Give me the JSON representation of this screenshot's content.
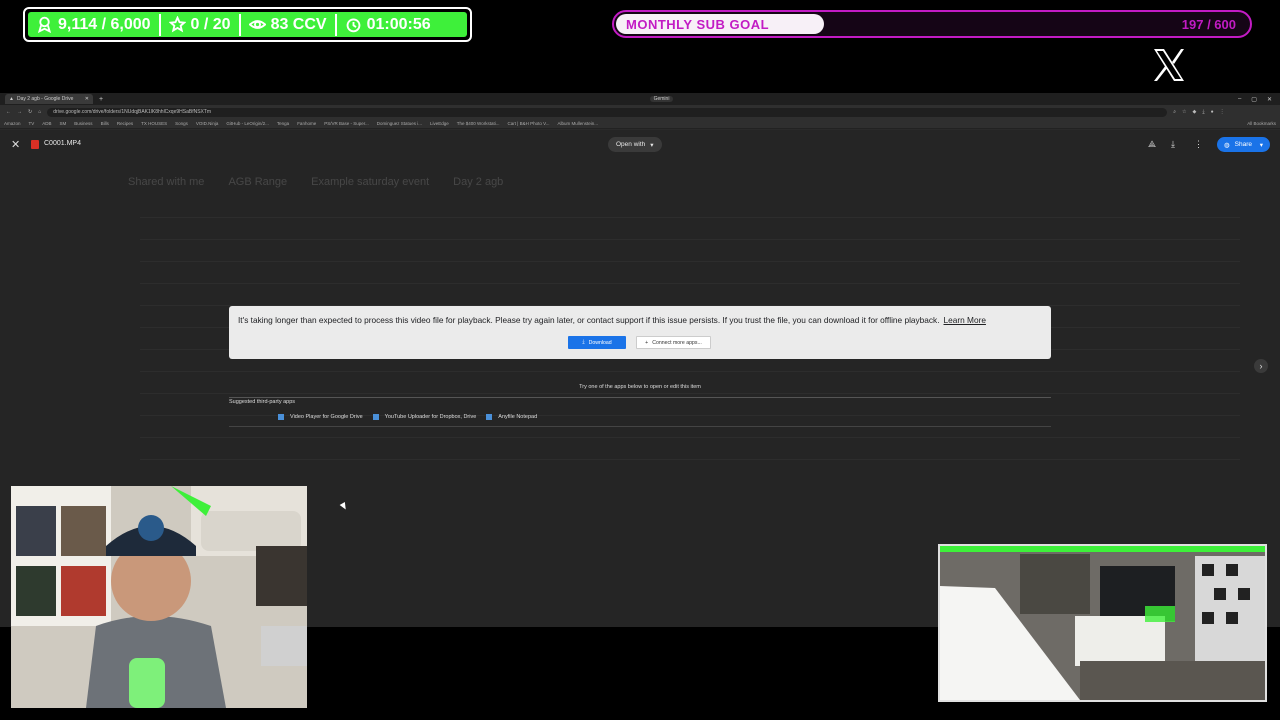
{
  "overlay": {
    "stats": [
      {
        "icon": "award-icon",
        "value": "9,114 / 6,000"
      },
      {
        "icon": "star-icon",
        "value": "0 / 20"
      },
      {
        "icon": "eye-icon",
        "value": "83 CCV"
      },
      {
        "icon": "timer-icon",
        "value": "01:00:56"
      }
    ],
    "goal": {
      "label": "MONTHLY SUB GOAL",
      "count": "197 / 600",
      "progress": 0.33
    },
    "social_icon": "x-logo-icon"
  },
  "browser": {
    "tab_title": "Day 2 agb - Google Drive",
    "tab_right_chip": "Gemini",
    "url": "drive.google.com/drive/folders/1NUdqjBAK1lK8hhlCxqe9HSaBfNSXTm",
    "bookmarks": [
      "Amazon",
      "TV",
      "ADB",
      "SM",
      "Business",
      "Bills",
      "Recipes",
      "TX HOUSES",
      "Songs",
      "VOID.Ninja",
      "GitHub - LeOrigin/2...",
      "Tenga",
      "Fanhome",
      "PS/VR Base - Super...",
      "Dominguez Statues i...",
      "LiveEdge",
      "The $400 Workstati...",
      "Cart | B&H Photo V...",
      "Album Mullenstein..."
    ],
    "bookmarks_all": "All Bookmarks"
  },
  "viewer": {
    "file_name": "C0001.MP4",
    "open_with": "Open with",
    "share": "Share",
    "message": "It's taking longer than expected to process this video file for playback. Please try again later, or contact support if this issue persists. If you trust the file, you can download it for offline playback.",
    "learn_more": "Learn More",
    "download_label": "Download",
    "connect_label": "Connect more apps...",
    "try_apps": "Try one of the apps below to open or edit this item",
    "suggested_title": "Suggested third-party apps",
    "apps": [
      "Video Player for Google Drive",
      "YouTube Uploader for Dropbox, Drive",
      "Anyfile Notepad"
    ],
    "background_breadcrumbs": [
      "Shared with me",
      "AGB Range",
      "Example saturday event",
      "Day 2 agb"
    ]
  },
  "colors": {
    "stats_green": "#3ef03a",
    "goal_magenta": "#c21bc4",
    "drive_blue": "#1a73e8"
  }
}
